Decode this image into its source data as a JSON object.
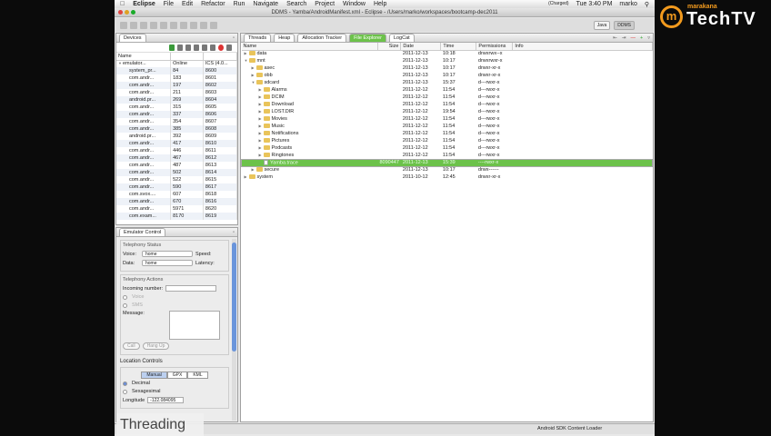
{
  "menubar": {
    "app": "Eclipse",
    "items": [
      "File",
      "Edit",
      "Refactor",
      "Run",
      "Navigate",
      "Search",
      "Project",
      "Window",
      "Help"
    ],
    "battery": "(Charged)",
    "clock": "Tue 3:40 PM",
    "user": "marko"
  },
  "window_title": "DDMS - Yamba/AndroidManifest.xml - Eclipse - /Users/marko/workspaces/bootcamp-dec2011",
  "perspectives": [
    "Java",
    "DDMS"
  ],
  "devices": {
    "tab": "Devices",
    "columns": [
      "Name",
      "",
      ""
    ],
    "emulator": {
      "name": "emulator...",
      "state": "Online",
      "version": "ICS (4.0..."
    },
    "rows": [
      [
        "system_pr...",
        "84",
        "8600"
      ],
      [
        "com.andr...",
        "183",
        "8601"
      ],
      [
        "com.andr...",
        "197",
        "8602"
      ],
      [
        "com.andr...",
        "211",
        "8603"
      ],
      [
        "android.pr...",
        "269",
        "8604"
      ],
      [
        "com.andr...",
        "315",
        "8605"
      ],
      [
        "com.andr...",
        "337",
        "8606"
      ],
      [
        "com.andr...",
        "354",
        "8607"
      ],
      [
        "com.andr...",
        "385",
        "8608"
      ],
      [
        "android.pr...",
        "392",
        "8609"
      ],
      [
        "com.andr...",
        "417",
        "8610"
      ],
      [
        "com.andr...",
        "446",
        "8611"
      ],
      [
        "com.andr...",
        "467",
        "8612"
      ],
      [
        "com.andr...",
        "487",
        "8613"
      ],
      [
        "com.andr...",
        "502",
        "8614"
      ],
      [
        "com.andr...",
        "522",
        "8615"
      ],
      [
        "com.andr...",
        "590",
        "8617"
      ],
      [
        "com.svox....",
        "607",
        "8618"
      ],
      [
        "com.andr...",
        "670",
        "8616"
      ],
      [
        "com.andr...",
        "5971",
        "8620"
      ],
      [
        "com.exam...",
        "8170",
        "8619"
      ]
    ]
  },
  "emulator": {
    "tab": "Emulator Control",
    "telephony_status": "Telephony Status",
    "voice_label": "Voice:",
    "voice_value": "home",
    "speed_label": "Speed:",
    "data_label": "Data:",
    "data_value": "home",
    "latency_label": "Latency:",
    "telephony_actions": "Telephony Actions",
    "incoming_label": "Incoming number:",
    "voice_radio": "Voice",
    "sms_radio": "SMS",
    "message_label": "Message:",
    "call": "Call",
    "hangup": "Hang Up",
    "location": "Location Controls",
    "modes": [
      "Manual",
      "GPX",
      "KML"
    ],
    "decimal": "Decimal",
    "sexagesimal": "Sexagesimal",
    "longitude_label": "Longitude",
    "longitude_value": "-122.084095"
  },
  "tabs": [
    "Threads",
    "Heap",
    "Allocation Tracker",
    "File Explorer",
    "LogCat"
  ],
  "files": {
    "columns": [
      "Name",
      "Size",
      "Date",
      "Time",
      "Permissions",
      "Info"
    ],
    "rows": [
      {
        "d": 0,
        "open": false,
        "name": "data",
        "size": "",
        "date": "2011-12-13",
        "time": "10:18",
        "perm": "drwxrwx--x"
      },
      {
        "d": 0,
        "open": true,
        "name": "mnt",
        "size": "",
        "date": "2011-12-13",
        "time": "10:17",
        "perm": "drwxrwxr-x"
      },
      {
        "d": 1,
        "open": false,
        "name": "asec",
        "size": "",
        "date": "2011-12-13",
        "time": "10:17",
        "perm": "drwxr-xr-x"
      },
      {
        "d": 1,
        "open": false,
        "name": "obb",
        "size": "",
        "date": "2011-12-13",
        "time": "10:17",
        "perm": "drwxr-xr-x"
      },
      {
        "d": 1,
        "open": true,
        "name": "sdcard",
        "size": "",
        "date": "2011-12-13",
        "time": "15:37",
        "perm": "d---rwxr-x"
      },
      {
        "d": 2,
        "open": false,
        "name": "Alarms",
        "size": "",
        "date": "2011-12-12",
        "time": "11:54",
        "perm": "d---rwxr-x"
      },
      {
        "d": 2,
        "open": false,
        "name": "DCIM",
        "size": "",
        "date": "2011-12-12",
        "time": "11:54",
        "perm": "d---rwxr-x"
      },
      {
        "d": 2,
        "open": false,
        "name": "Download",
        "size": "",
        "date": "2011-12-12",
        "time": "11:54",
        "perm": "d---rwxr-x"
      },
      {
        "d": 2,
        "open": false,
        "name": "LOST.DIR",
        "size": "",
        "date": "2011-12-12",
        "time": "19:54",
        "perm": "d---rwxr-x"
      },
      {
        "d": 2,
        "open": false,
        "name": "Movies",
        "size": "",
        "date": "2011-12-12",
        "time": "11:54",
        "perm": "d---rwxr-x"
      },
      {
        "d": 2,
        "open": false,
        "name": "Music",
        "size": "",
        "date": "2011-12-12",
        "time": "11:54",
        "perm": "d---rwxr-x"
      },
      {
        "d": 2,
        "open": false,
        "name": "Notifications",
        "size": "",
        "date": "2011-12-12",
        "time": "11:54",
        "perm": "d---rwxr-x"
      },
      {
        "d": 2,
        "open": false,
        "name": "Pictures",
        "size": "",
        "date": "2011-12-12",
        "time": "11:54",
        "perm": "d---rwxr-x"
      },
      {
        "d": 2,
        "open": false,
        "name": "Podcasts",
        "size": "",
        "date": "2011-12-12",
        "time": "11:54",
        "perm": "d---rwxr-x"
      },
      {
        "d": 2,
        "open": false,
        "name": "Ringtones",
        "size": "",
        "date": "2011-12-12",
        "time": "11:54",
        "perm": "d---rwxr-x"
      },
      {
        "d": 2,
        "file": true,
        "sel": true,
        "name": "Yamba.trace",
        "size": "8090447",
        "date": "2011-12-13",
        "time": "15:39",
        "perm": "----rwxr-x"
      },
      {
        "d": 1,
        "open": false,
        "name": "secure",
        "size": "",
        "date": "2011-12-13",
        "time": "10:17",
        "perm": "drwx------"
      },
      {
        "d": 0,
        "open": false,
        "name": "system",
        "size": "",
        "date": "2011-10-12",
        "time": "12:45",
        "perm": "drwxr-xr-x"
      }
    ]
  },
  "status": "Android SDK Content Loader",
  "caption": "Threading",
  "logo": {
    "small": "marakana",
    "big": "TechTV"
  },
  "colors": {
    "accent": "#6cc24a",
    "logo": "#f29a1e"
  }
}
